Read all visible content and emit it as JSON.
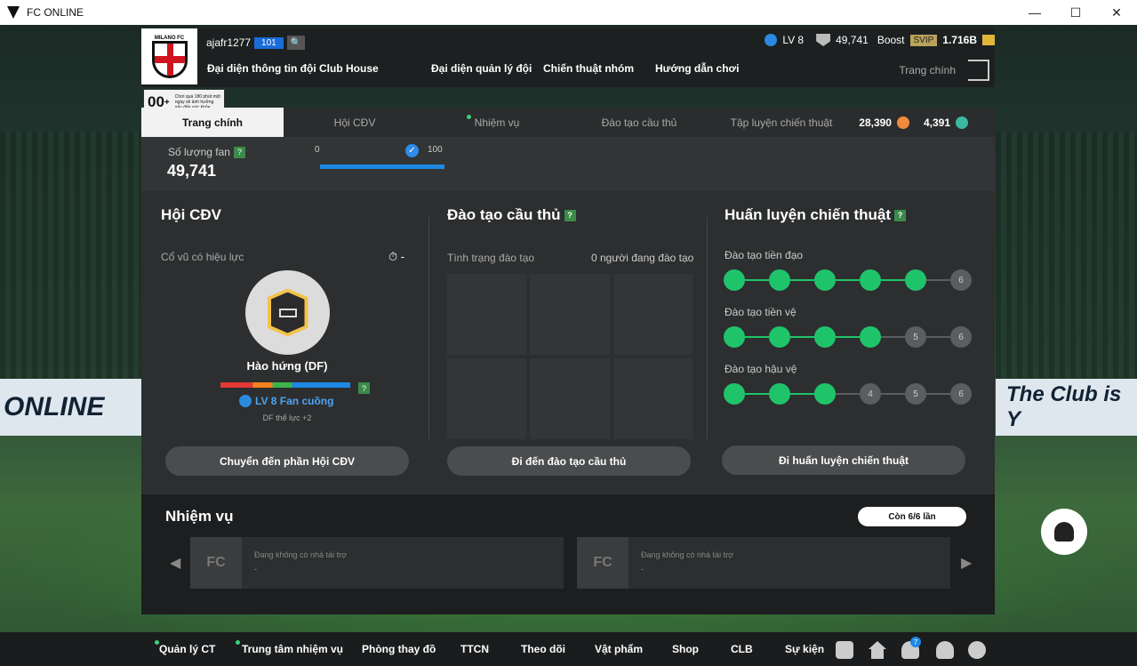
{
  "window": {
    "title": "FC ONLINE",
    "minimize": "—",
    "maximize": "☐",
    "close": "✕"
  },
  "club": {
    "logo_text": "MILANO FC"
  },
  "user": {
    "name": "ajafr1277",
    "level_badge": "101"
  },
  "stats": {
    "level": "LV 8",
    "fans": "49,741",
    "boost_label": "Boost",
    "svip": "SVIP",
    "balance": "1.716B"
  },
  "nav": {
    "items": [
      "Đại diện thông tin đội",
      "Club House",
      "Đại diện quản lý đội",
      "Chiến thuật nhóm",
      "Hướng dẫn chơi"
    ],
    "home": "Trang chính"
  },
  "age": {
    "number": "00",
    "plus": "+",
    "notice": "Chơi quá 180 phút một ngày sẽ ảnh hưởng xấu đến sức khỏe"
  },
  "tabs": [
    "Trang chính",
    "Hội CĐV",
    "Nhiệm vụ",
    "Đào tạo cầu thủ",
    "Tập luyện chiến thuật"
  ],
  "currency": {
    "a": "28,390",
    "b": "4,391"
  },
  "fans": {
    "label": "Số lượng fan",
    "help": "?",
    "value": "49,741",
    "min": "0",
    "max": "100"
  },
  "club_section": {
    "title": "Hội CĐV",
    "effective": "Cổ vũ có hiệu lực",
    "timer": "-",
    "mood": "Hào hứng (DF)",
    "level": "LV 8 Fan cuồng",
    "bonus": "DF thể lực +2",
    "button": "Chuyển đến phần Hội CĐV"
  },
  "training": {
    "title": "Đào tạo cầu thủ",
    "status": "Tình trạng đào tạo",
    "count": "0 người đang đào tạo",
    "button": "Đi đến đào tạo cầu thủ"
  },
  "tactics": {
    "title": "Huấn luyện chiến thuật",
    "rows": [
      {
        "label": "Đào tạo tiền đạo",
        "nodes": [
          "",
          "",
          "",
          "",
          "",
          "6"
        ],
        "active": 5
      },
      {
        "label": "Đào tạo tiền vệ",
        "nodes": [
          "",
          "",
          "",
          "",
          "5",
          "6"
        ],
        "active": 4
      },
      {
        "label": "Đào tạo hậu vệ",
        "nodes": [
          "",
          "",
          "",
          "4",
          "5",
          "6"
        ],
        "active": 3
      }
    ],
    "button": "Đi huấn luyện chiến thuật"
  },
  "missions": {
    "title": "Nhiệm vụ",
    "remain": "Còn 6/6 lần",
    "cards": [
      {
        "text": "Đang không có nhà tài trợ",
        "sub": "-"
      },
      {
        "text": "Đang không có nhà tài trợ",
        "sub": "-"
      }
    ]
  },
  "footer": {
    "items": [
      "Quản lý CT",
      "Trung tâm nhiệm vụ",
      "Phòng thay đồ",
      "TTCN",
      "Theo dõi",
      "Vật phẩm",
      "Shop",
      "CLB",
      "Sự kiện"
    ],
    "notif_count": "7"
  },
  "background": {
    "banner_left": "ONLINE",
    "banner_mid": "The Club",
    "banner_right": "The Club is Y"
  },
  "colors": {
    "accent": "#1fc46a",
    "blue": "#1e88e5"
  }
}
